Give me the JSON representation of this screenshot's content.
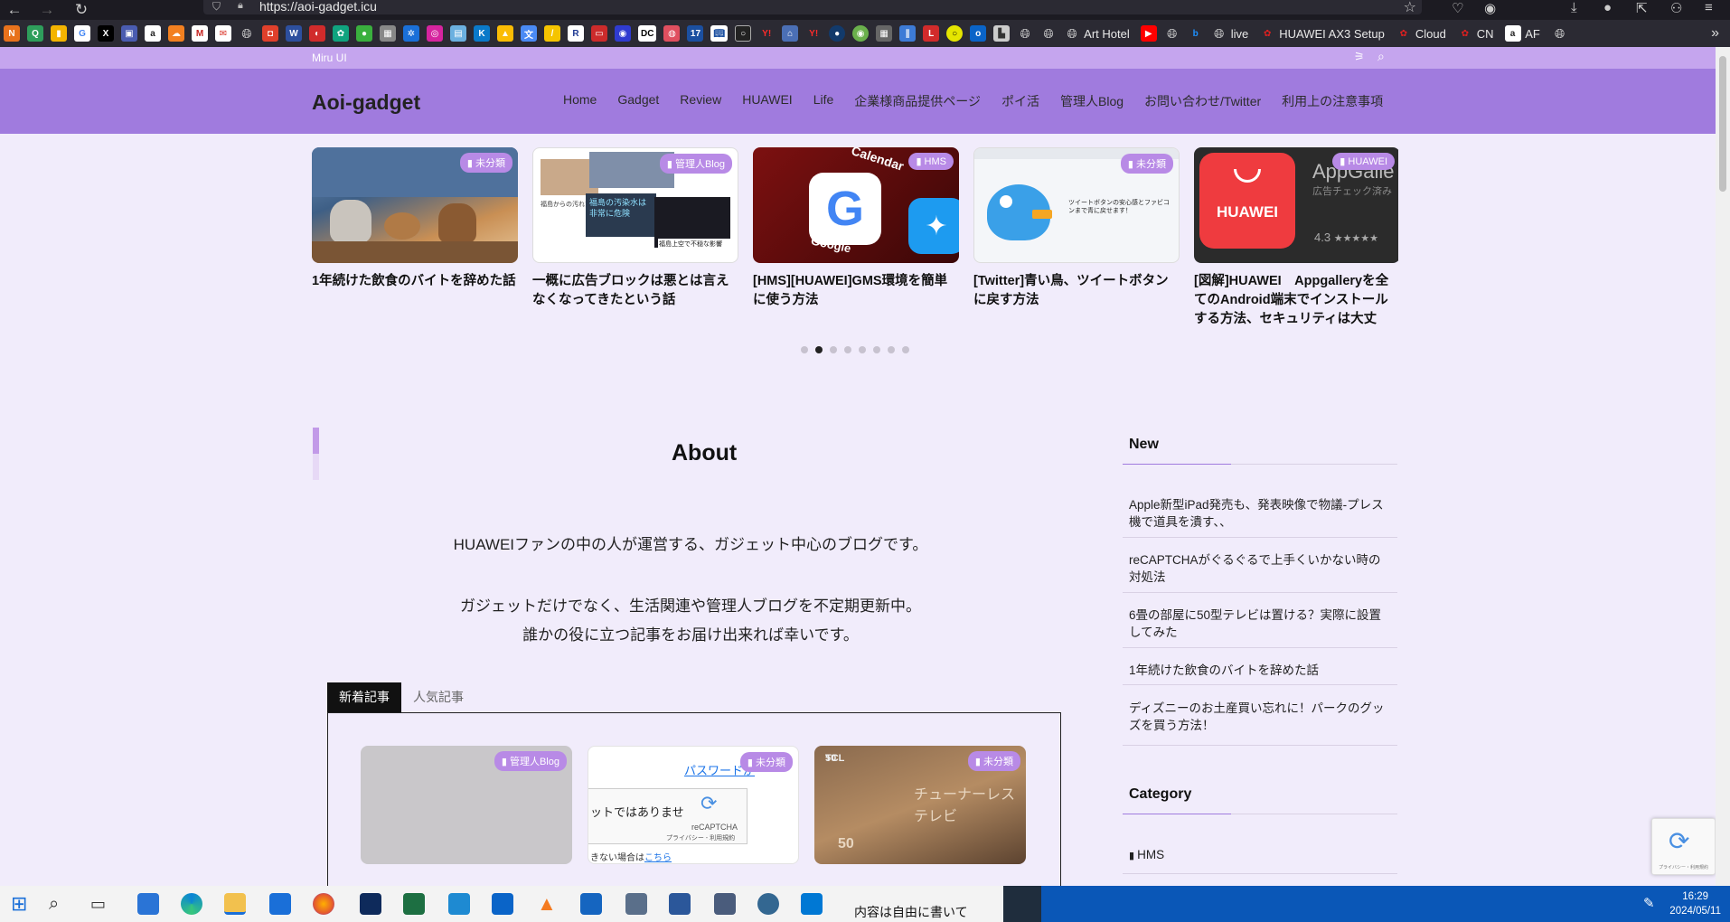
{
  "browser": {
    "url": "https://aoi-gadget.icu",
    "bookmarks_text": [
      "Art Hotel",
      "live",
      "HUAWEI AX3 Setup",
      "Cloud",
      "CN",
      "AF"
    ]
  },
  "site": {
    "tagline": "Miru UI",
    "logo": "Aoi-gadget",
    "nav": [
      "Home",
      "Gadget",
      "Review",
      "HUAWEI",
      "Life",
      "企業様商品提供ページ",
      "ポイ活",
      "管理人Blog",
      "お問い合わせ/Twitter",
      "利用上の注意事項"
    ]
  },
  "slider": [
    {
      "category": "未分類",
      "title": "1年続けた飲食のバイトを辞めた話"
    },
    {
      "category": "管理人Blog",
      "title": "一概に広告ブロックは悪とは言えなくなってきたという話",
      "img_text_1": "福島の汚染水は非常に危険",
      "img_text_2": "福島からの汚れた水",
      "img_text_3": "福島上空で不穏な影響"
    },
    {
      "category": "HMS",
      "title": "[HMS][HUAWEI]GMS環境を簡単に使う方法",
      "img_text_1": "Calendar",
      "img_text_2": "Google"
    },
    {
      "category": "未分類",
      "title": "[Twitter]青い鳥、ツイートボタンに戻す方法",
      "img_text_1": "ツイートボタンの安心感とファビコンまで青に戻せます！"
    },
    {
      "category": "HUAWEI",
      "title": "[図解]HUAWEI　Appgalleryを全てのAndroid端末でインストールする方法、セキュリティは大丈",
      "img_text_1": "HUAWEI",
      "img_text_2": "AppGalle",
      "img_text_3": "広告チェック済み",
      "img_text_4": "4.3"
    }
  ],
  "main": {
    "about_title": "About",
    "desc_1": "HUAWEIファンの中の人が運営する、ガジェット中心のブログです。",
    "desc_2": "ガジェットだけでなく、生活関連や管理人ブログを不定期更新中。",
    "desc_3": "誰かの役に立つ記事をお届け出来れば幸いです。",
    "tab_new": "新着記事",
    "tab_popular": "人気記事",
    "cards": [
      {
        "category": "管理人Blog"
      },
      {
        "category": "未分類",
        "img_text_1": "パスワードが",
        "img_text_2": "ットではありませ",
        "img_text_3": "reCAPTCHA",
        "img_text_4": "プライバシー - 利用規約",
        "img_text_5": "きない場合は",
        "img_text_6": "こちら"
      },
      {
        "category": "未分類",
        "img_text_1": "TCL",
        "img_text_2": "チューナーレステレビ",
        "img_text_3": "50"
      }
    ]
  },
  "sidebar": {
    "new_heading": "New",
    "new_items": [
      "Apple新型iPad発売も、発表映像で物議-プレス機で道具を潰す、、",
      "reCAPTCHAがぐるぐるで上手くいかない時の対処法",
      "6畳の部屋に50型テレビは置ける？実際に設置してみた",
      "1年続けた飲食のバイトを辞めた話",
      "ディズニーのお土産買い忘れに！パークのグッズを買う方法！"
    ],
    "category_heading": "Category",
    "categories": [
      "HMS"
    ]
  },
  "recaptcha_badge": "プライバシー・利用規約",
  "taskbar": {
    "time": "16:29",
    "date": "2024/05/11",
    "peek_text": "内容は自由に書いて"
  },
  "colors": {
    "header": "#a07bde",
    "top_strip": "#c5a5ee",
    "page_bg": "#f1ecfb",
    "category_badge": "#b88ae6"
  }
}
